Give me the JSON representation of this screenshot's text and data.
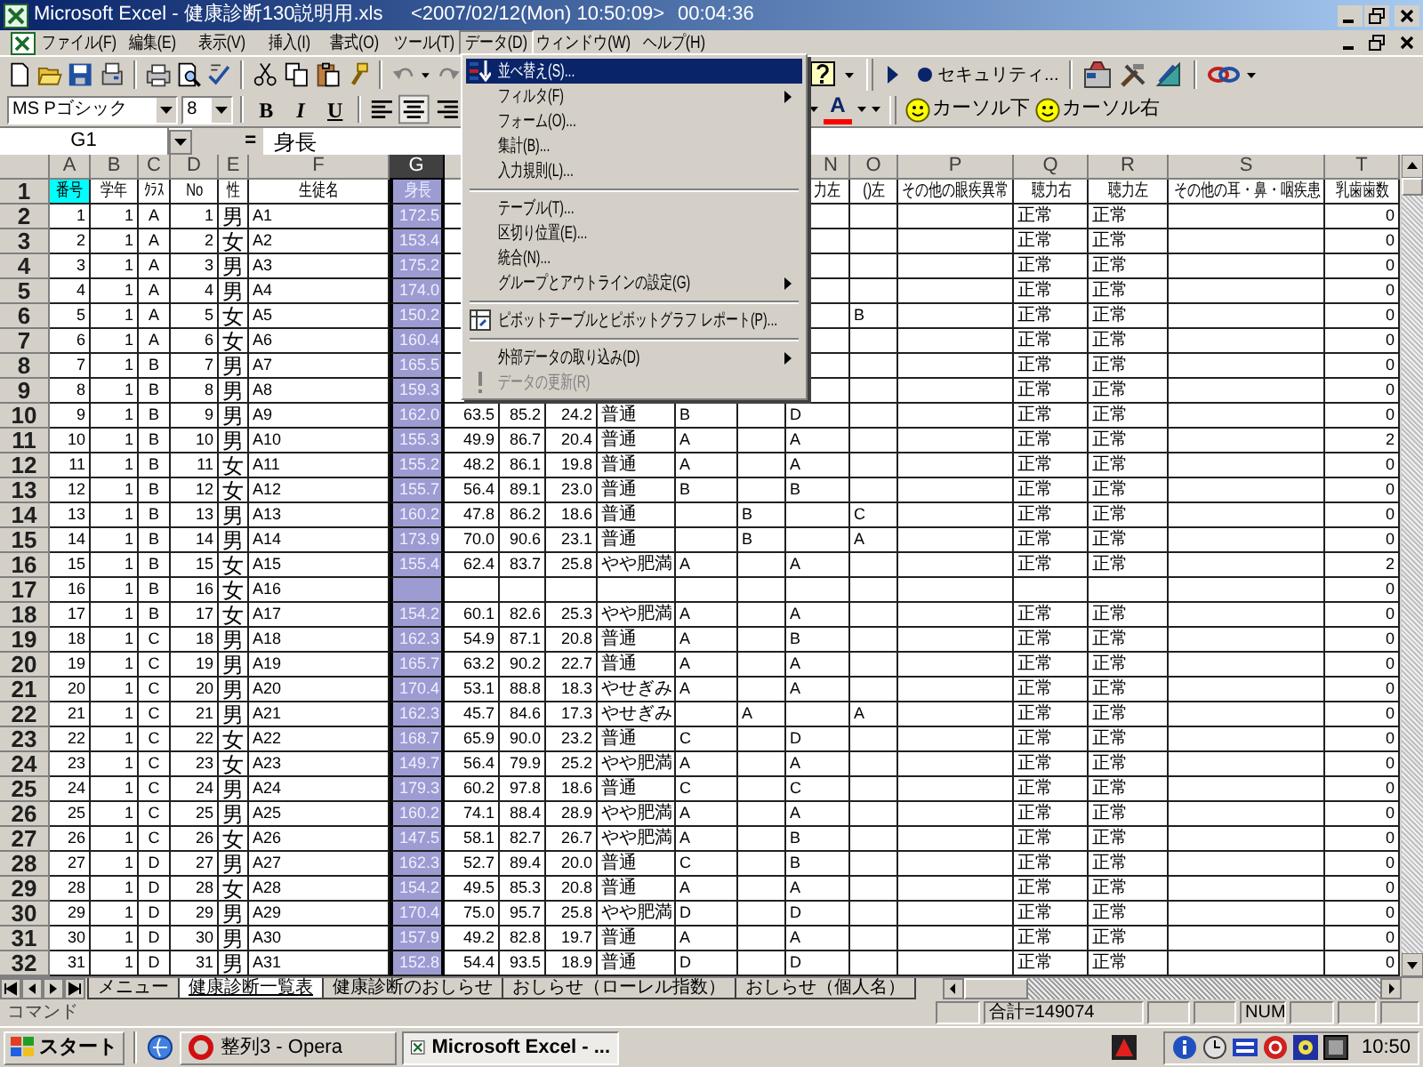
{
  "window": {
    "title": "Microsoft Excel - 健康診断130説明用.xls",
    "clock": "<2007/02/12(Mon) 10:50:09>",
    "timer": "00:04:36"
  },
  "menu_bar": [
    {
      "label": "ファイル(F)",
      "selected": false
    },
    {
      "label": "編集(E)",
      "selected": false
    },
    {
      "label": "表示(V)",
      "selected": false
    },
    {
      "label": "挿入(I)",
      "selected": false
    },
    {
      "label": "書式(O)",
      "selected": false
    },
    {
      "label": "ツール(T)",
      "selected": false
    },
    {
      "label": "データ(D)",
      "selected": true
    },
    {
      "label": "ウィンドウ(W)",
      "selected": false
    },
    {
      "label": "ヘルプ(H)",
      "selected": false
    }
  ],
  "security_button": "セキュリティ...",
  "font_field": {
    "value": "MS Pゴシック"
  },
  "size_field": {
    "value": "8"
  },
  "format_buttons": [
    {
      "label": "B",
      "selected": false
    },
    {
      "label": "I",
      "selected": false
    },
    {
      "label": "U",
      "selected": false
    }
  ],
  "font_color_button": "A",
  "macro_buttons": [
    "カーソル下",
    "カーソル右"
  ],
  "name_box": "G1",
  "formula_equals": "=",
  "formula": "身長",
  "columns": [
    {
      "label": "A",
      "selected": false
    },
    {
      "label": "B",
      "selected": false
    },
    {
      "label": "C",
      "selected": false
    },
    {
      "label": "D",
      "selected": false
    },
    {
      "label": "E",
      "selected": false
    },
    {
      "label": "F",
      "selected": false
    },
    {
      "label": "G",
      "selected": true
    },
    null,
    null,
    null,
    null,
    null,
    null,
    {
      "label": "N",
      "selected": false
    },
    {
      "label": "O",
      "selected": false
    },
    {
      "label": "P",
      "selected": false
    },
    {
      "label": "Q",
      "selected": false
    },
    {
      "label": "R",
      "selected": false
    },
    {
      "label": "S",
      "selected": false
    },
    {
      "label": "T",
      "selected": false
    }
  ],
  "rows": [
    {
      "header": "1",
      "cells": [
        {
          "text": "番号",
          "highlighted": true
        },
        "学年",
        "ｸﾗｽ",
        "No",
        "性",
        "生徒名",
        "身長",
        null,
        null,
        null,
        null,
        null,
        null,
        "力左",
        "()左",
        "その他の眼疾異常",
        "聴力右",
        "聴力左",
        "その他の耳・鼻・咽疾患",
        "乳歯歯数"
      ]
    },
    {
      "header": "2",
      "cells": [
        "1",
        "1",
        "A",
        "1",
        "男",
        "A1",
        "172.5",
        null,
        null,
        null,
        null,
        null,
        null,
        null,
        null,
        null,
        "正常",
        "正常",
        null,
        "0"
      ]
    },
    {
      "header": "3",
      "cells": [
        "2",
        "1",
        "A",
        "2",
        "女",
        "A2",
        "153.4",
        null,
        null,
        null,
        null,
        null,
        null,
        null,
        null,
        null,
        "正常",
        "正常",
        null,
        "0"
      ]
    },
    {
      "header": "4",
      "cells": [
        "3",
        "1",
        "A",
        "3",
        "男",
        "A3",
        "175.2",
        null,
        null,
        null,
        null,
        null,
        null,
        null,
        null,
        null,
        "正常",
        "正常",
        null,
        "0"
      ]
    },
    {
      "header": "5",
      "cells": [
        "4",
        "1",
        "A",
        "4",
        "男",
        "A4",
        "174.0",
        null,
        null,
        null,
        null,
        null,
        null,
        null,
        null,
        null,
        "正常",
        "正常",
        null,
        "0"
      ]
    },
    {
      "header": "6",
      "cells": [
        "5",
        "1",
        "A",
        "5",
        "女",
        "A5",
        "150.2",
        null,
        null,
        null,
        null,
        null,
        null,
        null,
        "B",
        null,
        "正常",
        "正常",
        null,
        "0"
      ]
    },
    {
      "header": "7",
      "cells": [
        "6",
        "1",
        "A",
        "6",
        "女",
        "A6",
        "160.4",
        null,
        null,
        null,
        null,
        null,
        null,
        null,
        null,
        null,
        "正常",
        "正常",
        null,
        "0"
      ]
    },
    {
      "header": "8",
      "cells": [
        "7",
        "1",
        "B",
        "7",
        "男",
        "A7",
        "165.5",
        null,
        null,
        null,
        null,
        null,
        null,
        null,
        null,
        null,
        "正常",
        "正常",
        null,
        "0"
      ]
    },
    {
      "header": "9",
      "cells": [
        "8",
        "1",
        "B",
        "8",
        "男",
        "A8",
        "159.3",
        null,
        null,
        null,
        null,
        null,
        null,
        null,
        null,
        null,
        "正常",
        "正常",
        null,
        "0"
      ]
    },
    {
      "header": "10",
      "cells": [
        "9",
        "1",
        "B",
        "9",
        "男",
        "A9",
        "162.0",
        "63.5",
        "85.2",
        "24.2",
        "普通",
        "B",
        null,
        "D",
        null,
        null,
        "正常",
        "正常",
        null,
        "0"
      ]
    },
    {
      "header": "11",
      "cells": [
        "10",
        "1",
        "B",
        "10",
        "男",
        "A10",
        "155.3",
        "49.9",
        "86.7",
        "20.4",
        "普通",
        "A",
        null,
        "A",
        null,
        null,
        "正常",
        "正常",
        null,
        "2"
      ]
    },
    {
      "header": "12",
      "cells": [
        "11",
        "1",
        "B",
        "11",
        "女",
        "A11",
        "155.2",
        "48.2",
        "86.1",
        "19.8",
        "普通",
        "A",
        null,
        "A",
        null,
        null,
        "正常",
        "正常",
        null,
        "0"
      ]
    },
    {
      "header": "13",
      "cells": [
        "12",
        "1",
        "B",
        "12",
        "女",
        "A12",
        "155.7",
        "56.4",
        "89.1",
        "23.0",
        "普通",
        "B",
        null,
        "B",
        null,
        null,
        "正常",
        "正常",
        null,
        "0"
      ]
    },
    {
      "header": "14",
      "cells": [
        "13",
        "1",
        "B",
        "13",
        "男",
        "A13",
        "160.2",
        "47.8",
        "86.2",
        "18.6",
        "普通",
        null,
        "B",
        null,
        "C",
        null,
        "正常",
        "正常",
        null,
        "0"
      ]
    },
    {
      "header": "15",
      "cells": [
        "14",
        "1",
        "B",
        "14",
        "男",
        "A14",
        "173.9",
        "70.0",
        "90.6",
        "23.1",
        "普通",
        null,
        "B",
        null,
        "A",
        null,
        "正常",
        "正常",
        null,
        "0"
      ]
    },
    {
      "header": "16",
      "cells": [
        "15",
        "1",
        "B",
        "15",
        "女",
        "A15",
        "155.4",
        "62.4",
        "83.7",
        "25.8",
        "やや肥満",
        "A",
        null,
        "A",
        null,
        null,
        "正常",
        "正常",
        null,
        "2"
      ]
    },
    {
      "header": "17",
      "cells": [
        "16",
        "1",
        "B",
        "16",
        "女",
        "A16",
        null,
        null,
        null,
        null,
        null,
        null,
        null,
        null,
        null,
        null,
        null,
        null,
        null,
        "0"
      ]
    },
    {
      "header": "18",
      "cells": [
        "17",
        "1",
        "B",
        "17",
        "女",
        "A17",
        "154.2",
        "60.1",
        "82.6",
        "25.3",
        "やや肥満",
        "A",
        null,
        "A",
        null,
        null,
        "正常",
        "正常",
        null,
        "0"
      ]
    },
    {
      "header": "19",
      "cells": [
        "18",
        "1",
        "C",
        "18",
        "男",
        "A18",
        "162.3",
        "54.9",
        "87.1",
        "20.8",
        "普通",
        "A",
        null,
        "B",
        null,
        null,
        "正常",
        "正常",
        null,
        "0"
      ]
    },
    {
      "header": "20",
      "cells": [
        "19",
        "1",
        "C",
        "19",
        "男",
        "A19",
        "165.7",
        "63.2",
        "90.2",
        "22.7",
        "普通",
        "A",
        null,
        "A",
        null,
        null,
        "正常",
        "正常",
        null,
        "0"
      ]
    },
    {
      "header": "21",
      "cells": [
        "20",
        "1",
        "C",
        "20",
        "男",
        "A20",
        "170.4",
        "53.1",
        "88.8",
        "18.3",
        "やせぎみ",
        "A",
        null,
        "A",
        null,
        null,
        "正常",
        "正常",
        null,
        "0"
      ]
    },
    {
      "header": "22",
      "cells": [
        "21",
        "1",
        "C",
        "21",
        "男",
        "A21",
        "162.3",
        "45.7",
        "84.6",
        "17.3",
        "やせぎみ",
        null,
        "A",
        null,
        "A",
        null,
        "正常",
        "正常",
        null,
        "0"
      ]
    },
    {
      "header": "23",
      "cells": [
        "22",
        "1",
        "C",
        "22",
        "女",
        "A22",
        "168.7",
        "65.9",
        "90.0",
        "23.2",
        "普通",
        "C",
        null,
        "D",
        null,
        null,
        "正常",
        "正常",
        null,
        "0"
      ]
    },
    {
      "header": "24",
      "cells": [
        "23",
        "1",
        "C",
        "23",
        "女",
        "A23",
        "149.7",
        "56.4",
        "79.9",
        "25.2",
        "やや肥満",
        "A",
        null,
        "A",
        null,
        null,
        "正常",
        "正常",
        null,
        "0"
      ]
    },
    {
      "header": "25",
      "cells": [
        "24",
        "1",
        "C",
        "24",
        "男",
        "A24",
        "179.3",
        "60.2",
        "97.8",
        "18.6",
        "普通",
        "C",
        null,
        "C",
        null,
        null,
        "正常",
        "正常",
        null,
        "0"
      ]
    },
    {
      "header": "26",
      "cells": [
        "25",
        "1",
        "C",
        "25",
        "男",
        "A25",
        "160.2",
        "74.1",
        "88.4",
        "28.9",
        "やや肥満",
        "A",
        null,
        "A",
        null,
        null,
        "正常",
        "正常",
        null,
        "0"
      ]
    },
    {
      "header": "27",
      "cells": [
        "26",
        "1",
        "C",
        "26",
        "女",
        "A26",
        "147.5",
        "58.1",
        "82.7",
        "26.7",
        "やや肥満",
        "A",
        null,
        "B",
        null,
        null,
        "正常",
        "正常",
        null,
        "0"
      ]
    },
    {
      "header": "28",
      "cells": [
        "27",
        "1",
        "D",
        "27",
        "男",
        "A27",
        "162.3",
        "52.7",
        "89.4",
        "20.0",
        "普通",
        "C",
        null,
        "B",
        null,
        null,
        "正常",
        "正常",
        null,
        "0"
      ]
    },
    {
      "header": "29",
      "cells": [
        "28",
        "1",
        "D",
        "28",
        "女",
        "A28",
        "154.2",
        "49.5",
        "85.3",
        "20.8",
        "普通",
        "A",
        null,
        "A",
        null,
        null,
        "正常",
        "正常",
        null,
        "0"
      ]
    },
    {
      "header": "30",
      "cells": [
        "29",
        "1",
        "D",
        "29",
        "男",
        "A29",
        "170.4",
        "75.0",
        "95.7",
        "25.8",
        "やや肥満",
        "D",
        null,
        "D",
        null,
        null,
        "正常",
        "正常",
        null,
        "0"
      ]
    },
    {
      "header": "31",
      "cells": [
        "30",
        "1",
        "D",
        "30",
        "男",
        "A30",
        "157.9",
        "49.2",
        "82.8",
        "19.7",
        "普通",
        "A",
        null,
        "A",
        null,
        null,
        "正常",
        "正常",
        null,
        "0"
      ]
    },
    {
      "header": "32",
      "cells": [
        "31",
        "1",
        "D",
        "31",
        "男",
        "A31",
        "152.8",
        "54.4",
        "93.5",
        "18.9",
        "普通",
        "D",
        null,
        "D",
        null,
        null,
        "正常",
        "正常",
        null,
        "0"
      ]
    }
  ],
  "data_menu": [
    {
      "kind": "item",
      "label": "並べ替え(S)...",
      "selected": true,
      "disabled": false,
      "submenu": false
    },
    {
      "kind": "item",
      "label": "フィルタ(F)",
      "selected": false,
      "disabled": false,
      "submenu": true
    },
    {
      "kind": "item",
      "label": "フォーム(O)...",
      "selected": false,
      "disabled": false,
      "submenu": false
    },
    {
      "kind": "item",
      "label": "集計(B)...",
      "selected": false,
      "disabled": false,
      "submenu": false
    },
    {
      "kind": "item",
      "label": "入力規則(L)...",
      "selected": false,
      "disabled": false,
      "submenu": false
    },
    {
      "kind": "separator"
    },
    {
      "kind": "item",
      "label": "テーブル(T)...",
      "selected": false,
      "disabled": false,
      "submenu": false
    },
    {
      "kind": "item",
      "label": "区切り位置(E)...",
      "selected": false,
      "disabled": false,
      "submenu": false
    },
    {
      "kind": "item",
      "label": "統合(N)...",
      "selected": false,
      "disabled": false,
      "submenu": false
    },
    {
      "kind": "item",
      "label": "グループとアウトラインの設定(G)",
      "selected": false,
      "disabled": false,
      "submenu": true
    },
    {
      "kind": "separator"
    },
    {
      "kind": "item",
      "label": "ピボットテーブルとピボットグラフ レポート(P)...",
      "selected": false,
      "disabled": false,
      "submenu": false
    },
    {
      "kind": "separator"
    },
    {
      "kind": "item",
      "label": "外部データの取り込み(D)",
      "selected": false,
      "disabled": false,
      "submenu": true
    },
    {
      "kind": "item",
      "label": "データの更新(R)",
      "selected": false,
      "disabled": true,
      "submenu": false
    }
  ],
  "sheet_tabs": [
    {
      "label": "メニュー",
      "selected": false
    },
    {
      "label": "健康診断一覧表",
      "selected": true
    },
    {
      "label": "健康診断のおしらせ",
      "selected": false
    },
    {
      "label": "おしらせ（ローレル指数）",
      "selected": false
    },
    {
      "label": "おしらせ（個人名）",
      "selected": false
    }
  ],
  "status_bar": {
    "mode": "コマンド",
    "sum": "合計=149074",
    "num": "NUM"
  },
  "taskbar": {
    "start": "スタート",
    "tasks": [
      {
        "label": "整列3 - Opera",
        "selected": false
      },
      {
        "label": "Microsoft Excel - ...",
        "selected": true
      }
    ],
    "clock": "10:50"
  }
}
